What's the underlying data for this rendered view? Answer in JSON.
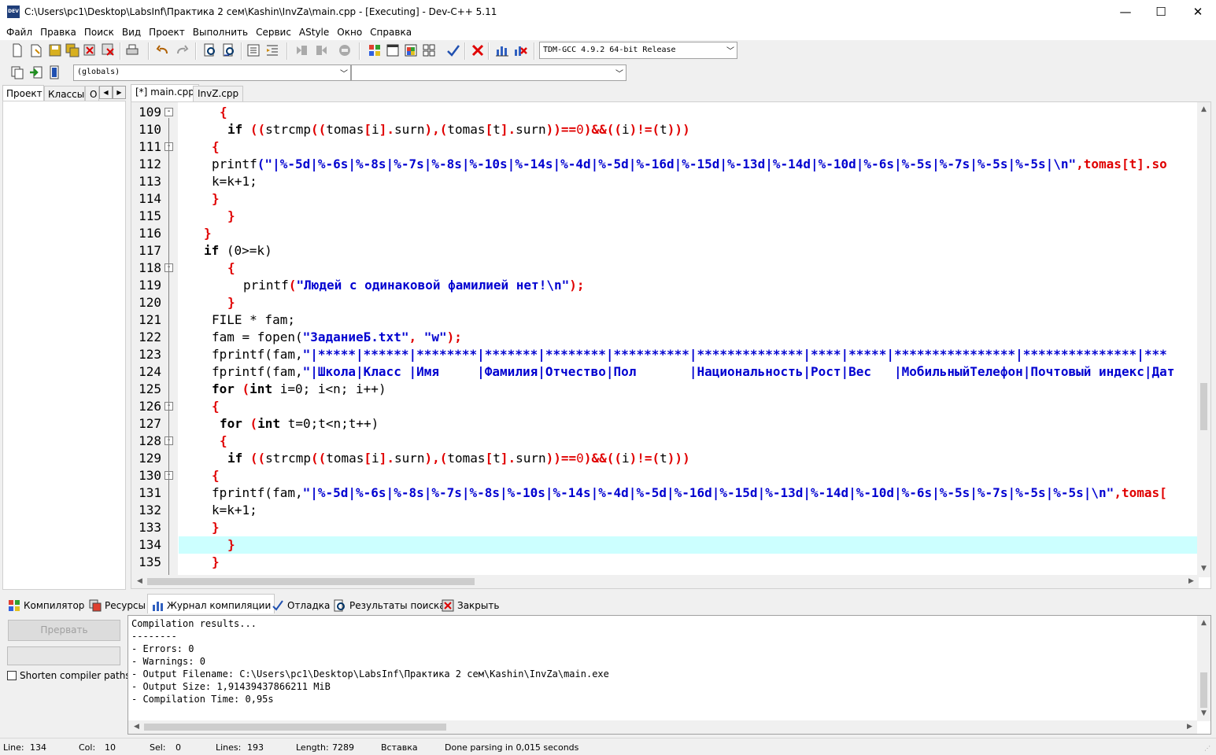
{
  "window": {
    "title": "C:\\Users\\pc1\\Desktop\\LabsInf\\Практика 2 сем\\Kashin\\InvZa\\main.cpp - [Executing] - Dev-C++ 5.11",
    "app_icon_text": "DEV",
    "minimize": "—",
    "maximize": "☐",
    "close": "✕"
  },
  "menu": [
    "Файл",
    "Правка",
    "Поиск",
    "Вид",
    "Проект",
    "Выполнить",
    "Сервис",
    "AStyle",
    "Окно",
    "Справка"
  ],
  "toolbar": {
    "compiler": "TDM-GCC 4.9.2 64-bit Release",
    "scope": "(globals)",
    "member": ""
  },
  "left_tabs": [
    "Проект",
    "Классы",
    "О"
  ],
  "editor_tabs": [
    "[*] main.cpp",
    "InvZ.cpp"
  ],
  "code_lines": [
    {
      "n": "109",
      "fold": "-"
    },
    {
      "n": "110",
      "fold": ""
    },
    {
      "n": "111",
      "fold": "-"
    },
    {
      "n": "112",
      "fold": ""
    },
    {
      "n": "113",
      "fold": ""
    },
    {
      "n": "114",
      "fold": ""
    },
    {
      "n": "115",
      "fold": ""
    },
    {
      "n": "116",
      "fold": ""
    },
    {
      "n": "117",
      "fold": ""
    },
    {
      "n": "118",
      "fold": "-"
    },
    {
      "n": "119",
      "fold": ""
    },
    {
      "n": "120",
      "fold": ""
    },
    {
      "n": "121",
      "fold": ""
    },
    {
      "n": "122",
      "fold": ""
    },
    {
      "n": "123",
      "fold": ""
    },
    {
      "n": "124",
      "fold": ""
    },
    {
      "n": "125",
      "fold": ""
    },
    {
      "n": "126",
      "fold": "-"
    },
    {
      "n": "127",
      "fold": ""
    },
    {
      "n": "128",
      "fold": "-"
    },
    {
      "n": "129",
      "fold": ""
    },
    {
      "n": "130",
      "fold": "-"
    },
    {
      "n": "131",
      "fold": ""
    },
    {
      "n": "132",
      "fold": ""
    },
    {
      "n": "133",
      "fold": ""
    },
    {
      "n": "134",
      "fold": ""
    },
    {
      "n": "135",
      "fold": ""
    }
  ],
  "code": {
    "l109": "{",
    "l110": [
      "if",
      " ((",
      "strcmp",
      "((",
      "tomas",
      "[",
      "i",
      "].",
      "surn",
      "),(",
      "tomas",
      "[",
      "t",
      "].",
      "surn",
      "))==",
      "0",
      ")&&((",
      "i",
      ")!=(",
      "t",
      ")))"
    ],
    "l111": "{",
    "l112_fn": "printf",
    "l112_str": "(\"|%-5d|%-6s|%-8s|%-7s|%-8s|%-10s|%-14s|%-4d|%-5d|%-16d|%-15d|%-13d|%-14d|%-10d|%-6s|%-5s|%-7s|%-5s|%-5s|\\n\"",
    "l112_tail": ",tomas[t].so",
    "l113": "k=k+1;",
    "l114": "}",
    "l115": "}",
    "l116": "}",
    "l117_kw": "if",
    "l117_rest": " (0>=k)",
    "l118": "{",
    "l119_fn": "printf",
    "l119_str": "\"Людей с одинаковой фамилией нет!\\n\"",
    "l120": "}",
    "l121": "FILE * fam;",
    "l122_a": "fam = fopen(",
    "l122_s1": "\"ЗаданиеБ.txt\"",
    "l122_s2": "\"w\"",
    "l123_fn": "fprintf(fam,",
    "l123_str": "\"|*****|******|********|*******|********|**********|**************|****|*****|****************|***************|***",
    "l124_fn": "fprintf(fam,",
    "l124_str": "\"|Школа|Класс |Имя     |Фамилия|Отчество|Пол       |Национальность|Рост|Вес   |МобильныйТелефон|Почтовый индекс|Дат",
    "l125_kw": "for",
    "l125_kw2": "int",
    "l125_rest": " i=0; i<n; i++)",
    "l126": "{",
    "l127_kw": "for",
    "l127_kw2": "int",
    "l127_rest": " t=0;t<n;t++)",
    "l128": "{",
    "l130": "{",
    "l131_fn": "fprintf(fam,",
    "l131_str": "\"|%-5d|%-6s|%-8s|%-7s|%-8s|%-10s|%-14s|%-4d|%-5d|%-16d|%-15d|%-13d|%-14d|%-10d|%-6s|%-5s|%-7s|%-5s|%-5s|\\n\"",
    "l131_tail": ",tomas[",
    "l132": "k=k+1;",
    "l133": "}",
    "l134": "}",
    "l135": "}"
  },
  "bottom_tabs": [
    "Компилятор",
    "Ресурсы",
    "Журнал компиляции",
    "Отладка",
    "Результаты поиска",
    "Закрыть"
  ],
  "abort_button": "Прервать",
  "shorten_label": "Shorten compiler paths",
  "log_lines": [
    "Compilation results...",
    "--------",
    "- Errors: 0",
    "- Warnings: 0",
    "- Output Filename: C:\\Users\\pc1\\Desktop\\LabsInf\\Практика 2 сем\\Kashin\\InvZa\\main.exe",
    "- Output Size: 1,91439437866211 MiB",
    "- Compilation Time: 0,95s"
  ],
  "status": {
    "line_label": "Line:",
    "line": "134",
    "col_label": "Col:",
    "col": "10",
    "sel_label": "Sel:",
    "sel": "0",
    "lines_label": "Lines:",
    "lines": "193",
    "length_label": "Length:",
    "length": "7289",
    "mode": "Вставка",
    "message": "Done parsing in 0,015 seconds"
  }
}
